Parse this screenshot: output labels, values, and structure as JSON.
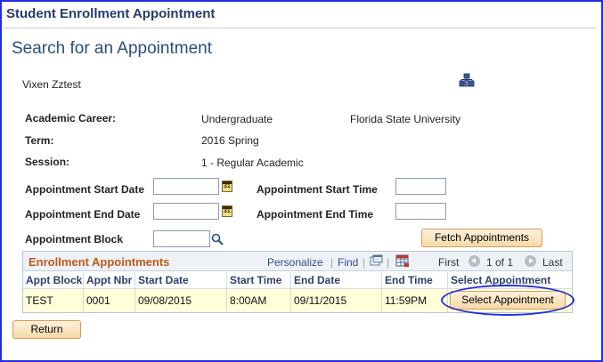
{
  "header": {
    "app_title": "Student Enrollment Appointment",
    "page_title": "Search for an Appointment"
  },
  "student": {
    "name": "Vixen Zztest"
  },
  "icons": {
    "org_chart": "org-chart-icon",
    "calendar": "calendar-icon",
    "lookup": "magnifier-lookup-icon",
    "new_window": "new-window-icon",
    "download": "spreadsheet-download-icon",
    "prev": "previous-arrow-icon",
    "next": "next-arrow-icon"
  },
  "info": {
    "career_label": "Academic Career:",
    "career_value": "Undergraduate",
    "institution": "Florida State University",
    "term_label": "Term:",
    "term_value": "2016 Spring",
    "session_label": "Session:",
    "session_value": "1 - Regular Academic"
  },
  "form": {
    "start_date_label": "Appointment Start Date",
    "start_date_value": "",
    "end_date_label": "Appointment End Date",
    "end_date_value": "",
    "start_time_label": "Appointment Start Time",
    "start_time_value": "",
    "end_time_label": "Appointment End Time",
    "end_time_value": "",
    "block_label": "Appointment Block",
    "block_value": "",
    "fetch_label": "Fetch Appointments"
  },
  "grid": {
    "title": "Enrollment Appointments",
    "personalize": "Personalize",
    "separator": "|",
    "find": "Find",
    "first": "First",
    "range": "1 of 1",
    "last": "Last",
    "columns": [
      "Appt Block",
      "Appt Nbr",
      "Start Date",
      "Start Time",
      "End Date",
      "End Time",
      "Select Appointment"
    ],
    "rows": [
      {
        "block": "TEST",
        "nbr": "0001",
        "start_date": "09/08/2015",
        "start_time": "8:00AM",
        "end_date": "09/11/2015",
        "end_time": "11:59PM",
        "select_label": "Select Appointment"
      }
    ]
  },
  "footer": {
    "return_label": "Return"
  },
  "colors": {
    "accent_border": "#1f2fe0",
    "grid_title": "#c05a1a",
    "button_fill": "#f7d9a8",
    "row_highlight": "#ffffd9"
  }
}
